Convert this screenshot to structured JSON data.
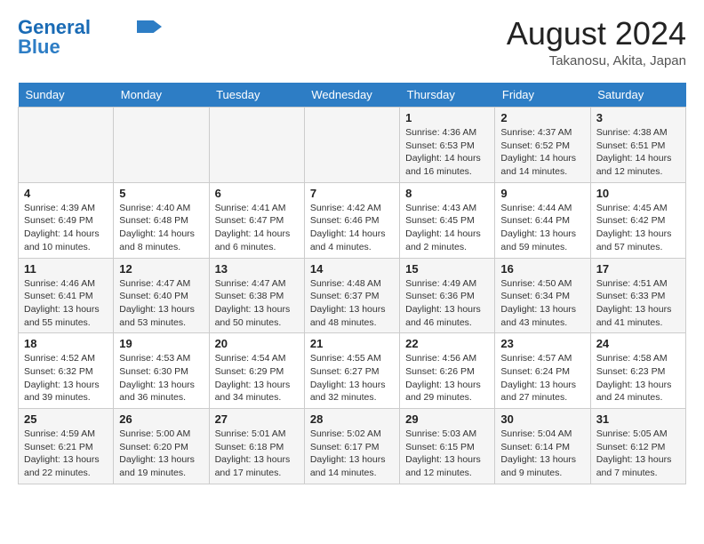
{
  "header": {
    "logo_line1": "General",
    "logo_line2": "Blue",
    "month_year": "August 2024",
    "location": "Takanosu, Akita, Japan"
  },
  "days_of_week": [
    "Sunday",
    "Monday",
    "Tuesday",
    "Wednesday",
    "Thursday",
    "Friday",
    "Saturday"
  ],
  "weeks": [
    [
      {
        "day": "",
        "info": ""
      },
      {
        "day": "",
        "info": ""
      },
      {
        "day": "",
        "info": ""
      },
      {
        "day": "",
        "info": ""
      },
      {
        "day": "1",
        "info": "Sunrise: 4:36 AM\nSunset: 6:53 PM\nDaylight: 14 hours\nand 16 minutes."
      },
      {
        "day": "2",
        "info": "Sunrise: 4:37 AM\nSunset: 6:52 PM\nDaylight: 14 hours\nand 14 minutes."
      },
      {
        "day": "3",
        "info": "Sunrise: 4:38 AM\nSunset: 6:51 PM\nDaylight: 14 hours\nand 12 minutes."
      }
    ],
    [
      {
        "day": "4",
        "info": "Sunrise: 4:39 AM\nSunset: 6:49 PM\nDaylight: 14 hours\nand 10 minutes."
      },
      {
        "day": "5",
        "info": "Sunrise: 4:40 AM\nSunset: 6:48 PM\nDaylight: 14 hours\nand 8 minutes."
      },
      {
        "day": "6",
        "info": "Sunrise: 4:41 AM\nSunset: 6:47 PM\nDaylight: 14 hours\nand 6 minutes."
      },
      {
        "day": "7",
        "info": "Sunrise: 4:42 AM\nSunset: 6:46 PM\nDaylight: 14 hours\nand 4 minutes."
      },
      {
        "day": "8",
        "info": "Sunrise: 4:43 AM\nSunset: 6:45 PM\nDaylight: 14 hours\nand 2 minutes."
      },
      {
        "day": "9",
        "info": "Sunrise: 4:44 AM\nSunset: 6:44 PM\nDaylight: 13 hours\nand 59 minutes."
      },
      {
        "day": "10",
        "info": "Sunrise: 4:45 AM\nSunset: 6:42 PM\nDaylight: 13 hours\nand 57 minutes."
      }
    ],
    [
      {
        "day": "11",
        "info": "Sunrise: 4:46 AM\nSunset: 6:41 PM\nDaylight: 13 hours\nand 55 minutes."
      },
      {
        "day": "12",
        "info": "Sunrise: 4:47 AM\nSunset: 6:40 PM\nDaylight: 13 hours\nand 53 minutes."
      },
      {
        "day": "13",
        "info": "Sunrise: 4:47 AM\nSunset: 6:38 PM\nDaylight: 13 hours\nand 50 minutes."
      },
      {
        "day": "14",
        "info": "Sunrise: 4:48 AM\nSunset: 6:37 PM\nDaylight: 13 hours\nand 48 minutes."
      },
      {
        "day": "15",
        "info": "Sunrise: 4:49 AM\nSunset: 6:36 PM\nDaylight: 13 hours\nand 46 minutes."
      },
      {
        "day": "16",
        "info": "Sunrise: 4:50 AM\nSunset: 6:34 PM\nDaylight: 13 hours\nand 43 minutes."
      },
      {
        "day": "17",
        "info": "Sunrise: 4:51 AM\nSunset: 6:33 PM\nDaylight: 13 hours\nand 41 minutes."
      }
    ],
    [
      {
        "day": "18",
        "info": "Sunrise: 4:52 AM\nSunset: 6:32 PM\nDaylight: 13 hours\nand 39 minutes."
      },
      {
        "day": "19",
        "info": "Sunrise: 4:53 AM\nSunset: 6:30 PM\nDaylight: 13 hours\nand 36 minutes."
      },
      {
        "day": "20",
        "info": "Sunrise: 4:54 AM\nSunset: 6:29 PM\nDaylight: 13 hours\nand 34 minutes."
      },
      {
        "day": "21",
        "info": "Sunrise: 4:55 AM\nSunset: 6:27 PM\nDaylight: 13 hours\nand 32 minutes."
      },
      {
        "day": "22",
        "info": "Sunrise: 4:56 AM\nSunset: 6:26 PM\nDaylight: 13 hours\nand 29 minutes."
      },
      {
        "day": "23",
        "info": "Sunrise: 4:57 AM\nSunset: 6:24 PM\nDaylight: 13 hours\nand 27 minutes."
      },
      {
        "day": "24",
        "info": "Sunrise: 4:58 AM\nSunset: 6:23 PM\nDaylight: 13 hours\nand 24 minutes."
      }
    ],
    [
      {
        "day": "25",
        "info": "Sunrise: 4:59 AM\nSunset: 6:21 PM\nDaylight: 13 hours\nand 22 minutes."
      },
      {
        "day": "26",
        "info": "Sunrise: 5:00 AM\nSunset: 6:20 PM\nDaylight: 13 hours\nand 19 minutes."
      },
      {
        "day": "27",
        "info": "Sunrise: 5:01 AM\nSunset: 6:18 PM\nDaylight: 13 hours\nand 17 minutes."
      },
      {
        "day": "28",
        "info": "Sunrise: 5:02 AM\nSunset: 6:17 PM\nDaylight: 13 hours\nand 14 minutes."
      },
      {
        "day": "29",
        "info": "Sunrise: 5:03 AM\nSunset: 6:15 PM\nDaylight: 13 hours\nand 12 minutes."
      },
      {
        "day": "30",
        "info": "Sunrise: 5:04 AM\nSunset: 6:14 PM\nDaylight: 13 hours\nand 9 minutes."
      },
      {
        "day": "31",
        "info": "Sunrise: 5:05 AM\nSunset: 6:12 PM\nDaylight: 13 hours\nand 7 minutes."
      }
    ]
  ]
}
